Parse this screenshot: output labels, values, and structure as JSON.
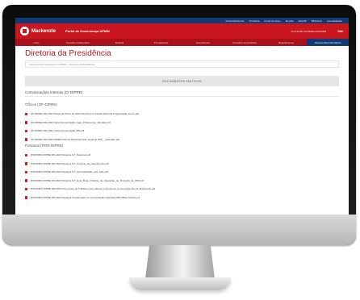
{
  "topbar": {
    "links": [
      "Portal Mackenzie",
      "Ouvidoria",
      "Portal do Aluno",
      "Moodle",
      "MackID",
      "Biblioteca",
      "Acessibilidade"
    ]
  },
  "header": {
    "logo_text": "Mackenzie",
    "portal_title": "Portal de Governança UPMM",
    "user_name": "ALUNA DE OLIVEIRA PRADIER",
    "logout_label": "Sair"
  },
  "nav": {
    "items": [
      "Início",
      "Conselho Deliberativo",
      "Reitoria",
      "Pró-Reitorias",
      "Vice-Reitoria",
      "Conselho Universitário",
      "Regulamentos",
      "Documentos Normativos"
    ]
  },
  "page": {
    "title": "Diretoria da Presidência",
    "breadcrumb": "Documentos Normativos  >  DIPRE  >  Diretoria da Presidência"
  },
  "documents": {
    "bar_label": "DOCUMENTOS EMITIDOS",
    "section_title": "Comunicações Internas (CI-DIPRE)",
    "ofícios_title": "Ofícios (OF-DIPRE)",
    "ofícios": [
      "OF-DIPRE 001-2023 Resposta Ofício de 2023 Diretrizes Comissão Eleitoral Programação anexo.pdf",
      "OF-DIPRE 002-2023 Carta Apresentação Lojas_Professores_Alterado.pdf",
      "OF-DIPRE 003-2023 Carta Apresentação IPM.pdf",
      "OF-DIPRE 004-2023 DIREM Informa Representante Legal do IPM_ _Assinado.pdf"
    ],
    "portarias_title": "Portarias (POR-DIPRE)",
    "portarias": [
      "PORTARIA DIPRE 001-2023 Designa GT_Sistemas.pdf",
      "PORTARIA DIPRE 002-2023 Designa GT_Controle_de_Atendimento.pdf",
      "PORTARIA DIPRE 003-2023 Designa GT_Informatização_das_Atas.pdf",
      "PORTARIA DIPRE 004-2023 Designa GT_Guia_Boas_Práticas_de_Operação_de_Proteção_de_IPM.pdf",
      "PORTARIA DIPRE 005-2023 Cria Grupo de Trabalho para elaborar proposta de comunicação Rio do Mackenzie.pdf",
      "PORTARIA DIPRE 006-2023 Designa Coordenador de Comunicação Aplicada (GRH Blue) Mundo.pdf"
    ]
  }
}
